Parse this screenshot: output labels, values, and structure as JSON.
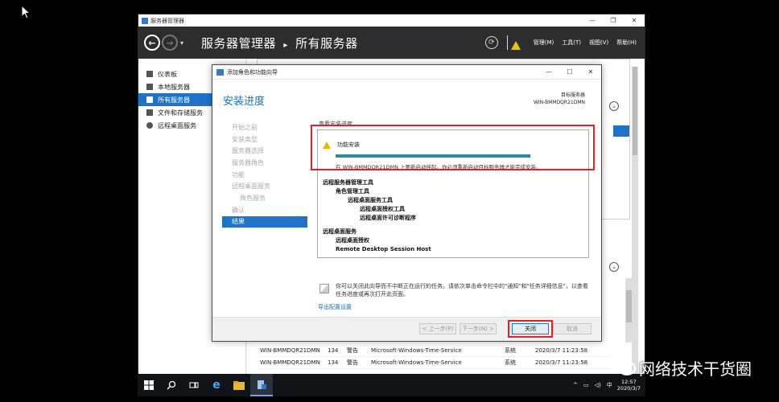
{
  "server_manager": {
    "window_title": "服务器管理器",
    "breadcrumb_app": "服务器管理器",
    "breadcrumb_sep": "▸",
    "breadcrumb_page": "所有服务器",
    "menu": [
      "管理(M)",
      "工具(T)",
      "视图(V)",
      "帮助(H)"
    ],
    "sidebar": [
      {
        "label": "仪表板",
        "icon": "dashboard-icon"
      },
      {
        "label": "本地服务器",
        "icon": "server-icon"
      },
      {
        "label": "所有服务器",
        "icon": "servers-icon",
        "active": true
      },
      {
        "label": "文件和存储服务",
        "icon": "storage-icon"
      },
      {
        "label": "远程桌面服务",
        "icon": "remote-desktop-icon"
      }
    ],
    "events": [
      {
        "server": "WIN-BMMDQR21DMN",
        "id": "134",
        "level": "警告",
        "source": "Microsoft-Windows-Time-Service",
        "log": "系统",
        "date": "2020/3/7 11:23:58"
      },
      {
        "server": "WIN-BMMDQR21DMN",
        "id": "134",
        "level": "警告",
        "source": "Microsoft-Windows-Time-Service",
        "log": "系统",
        "date": "2020/3/7 11:23:58"
      }
    ]
  },
  "wizard": {
    "title": "添加角色和功能向导",
    "heading": "安装进度",
    "dest_label": "目标服务器",
    "dest_server": "WIN-BMMDQR21DMN",
    "steps": [
      {
        "label": "开始之前"
      },
      {
        "label": "安装类型"
      },
      {
        "label": "服务器选择"
      },
      {
        "label": "服务器角色"
      },
      {
        "label": "功能"
      },
      {
        "label": "远程桌面服务"
      },
      {
        "label": "角色服务",
        "sub": true
      },
      {
        "label": "确认"
      },
      {
        "label": "结果",
        "active": true
      }
    ],
    "progress_label": "查看安装进度",
    "progress_value": 1.0,
    "status_title": "功能安装",
    "status_note": "在 WIN-BMMDQR21DMN 上要新启动挂起。你必须重新启动目标服务器才能完成安装。",
    "tree": {
      "g1": "远程服务器管理工具",
      "g1a": "角色管理工具",
      "g1b": "远程桌面服务工具",
      "g1c": "远程桌面授权工具",
      "g1d": "远程桌面许可诊断程序",
      "g2": "远程桌面服务",
      "g2a": "远程桌面授权",
      "g2b": "Remote Desktop Session Host"
    },
    "info_text": "你可以关闭此向导而不中断正在运行的任务。请依次单击命令栏中的\"通知\"和\"任务详细信息\"，以查看任务进度或再次打开此页面。",
    "export_link": "导出配置设置",
    "buttons": {
      "prev": "< 上一步(P)",
      "next": "下一步(N) >",
      "close": "关闭",
      "cancel": "取消"
    }
  },
  "taskbar": {
    "ime": "中",
    "time": "12:57",
    "date": "2020/3/7"
  },
  "watermark": "网络技术干货圈"
}
